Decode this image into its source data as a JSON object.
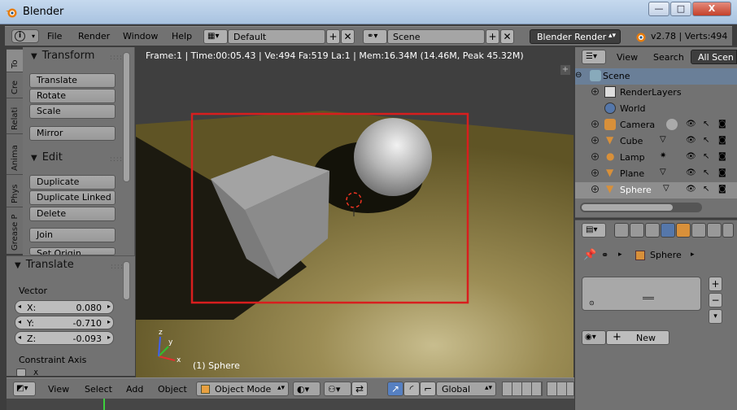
{
  "window": {
    "title": "Blender",
    "minimize_label": "—",
    "maximize_label": "□",
    "close_label": "X"
  },
  "info_header": {
    "menus": [
      "File",
      "Render",
      "Window",
      "Help"
    ],
    "screen_layout": "Default",
    "scene": "Scene",
    "render_engine": "Blender Render",
    "stats": "v2.78 | Verts:494"
  },
  "tool_tabs": [
    "To",
    "Cre",
    "Relati",
    "Anima",
    "Phys",
    "Grease P"
  ],
  "tool_shelf": {
    "transform_header": "Transform",
    "transform_buttons": [
      "Translate",
      "Rotate",
      "Scale"
    ],
    "mirror": "Mirror",
    "edit_header": "Edit",
    "edit_buttons": [
      "Duplicate",
      "Duplicate Linked",
      "Delete"
    ],
    "join": "Join",
    "set_origin": "Set Origin"
  },
  "operator_panel": {
    "header": "Translate",
    "vector_label": "Vector",
    "x_label": "X:",
    "x_value": "0.080",
    "y_label": "Y:",
    "y_value": "-0.710",
    "z_label": "Z:",
    "z_value": "-0.093",
    "constraint_label": "Constraint Axis",
    "constraint_x": "X"
  },
  "viewport": {
    "info": "Frame:1 | Time:00:05.43 | Ve:494 Fa:519 La:1 | Mem:16.34M (14.46M, Peak 45.32M)",
    "object_label": "(1) Sphere",
    "axis_x": "x",
    "axis_y": "y",
    "axis_z": "z"
  },
  "view_header": {
    "menus": [
      "View",
      "Select",
      "Add",
      "Object"
    ],
    "mode": "Object Mode",
    "orientation": "Global"
  },
  "outliner": {
    "view_label": "View",
    "search_label": "Search",
    "filter_label": "All Scen",
    "rows": [
      {
        "name": "Scene",
        "indent": 0
      },
      {
        "name": "RenderLayers",
        "indent": 1
      },
      {
        "name": "World",
        "indent": 1
      },
      {
        "name": "Camera",
        "indent": 1
      },
      {
        "name": "Cube",
        "indent": 1
      },
      {
        "name": "Lamp",
        "indent": 1
      },
      {
        "name": "Plane",
        "indent": 1
      },
      {
        "name": "Sphere",
        "indent": 1
      }
    ]
  },
  "properties": {
    "breadcrumb_object": "Sphere",
    "new_button": "New"
  },
  "colors": {
    "accent_blue": "#5680c2",
    "selection_red": "#d81e1e",
    "timeline_green": "#3cd13c"
  }
}
